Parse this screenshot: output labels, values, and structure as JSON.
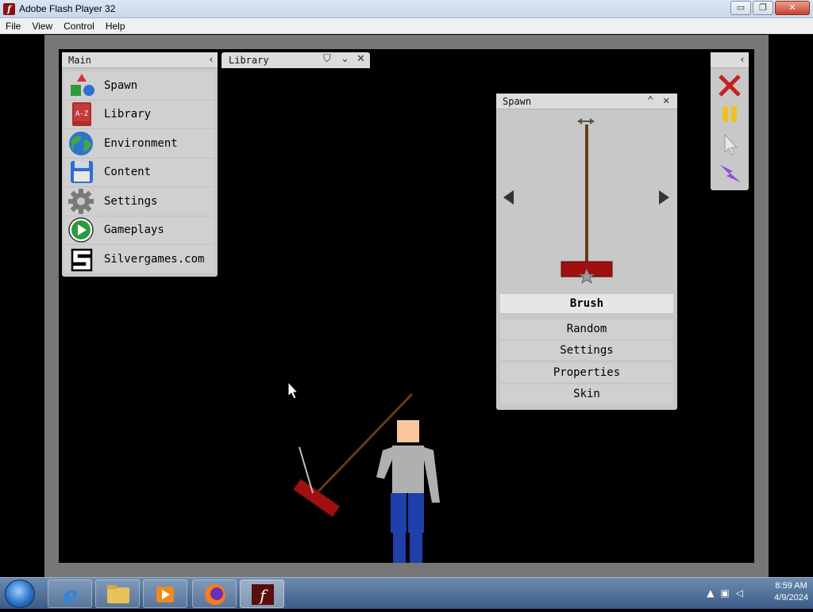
{
  "window": {
    "title": "Adobe Flash Player 32",
    "app_icon": "f",
    "minimize_icon": "▭",
    "restore_icon": "❐",
    "close_icon": "✕"
  },
  "menubar": {
    "items": [
      "File",
      "View",
      "Control",
      "Help"
    ]
  },
  "main_panel": {
    "title": "Main",
    "collapse_icon": "‹",
    "items": [
      {
        "label": "Spawn",
        "icon": "spawn-shapes-icon"
      },
      {
        "label": "Library",
        "icon": "library-book-icon"
      },
      {
        "label": "Environment",
        "icon": "globe-icon"
      },
      {
        "label": "Content",
        "icon": "floppy-disk-icon"
      },
      {
        "label": "Settings",
        "icon": "gear-icon"
      },
      {
        "label": "Gameplays",
        "icon": "play-icon"
      },
      {
        "label": "Silvergames.com",
        "icon": "silvergames-logo-icon"
      }
    ]
  },
  "library_tab": {
    "title": "Library",
    "shield_icon": "⛉",
    "chevron_icon": "⌄",
    "close_icon": "✕"
  },
  "spawn_panel": {
    "title": "Spawn",
    "collapse_icon": "⌃",
    "close_icon": "✕",
    "selected_item": "Brush",
    "buttons": [
      "Random",
      "Settings",
      "Properties",
      "Skin"
    ]
  },
  "tool_panel": {
    "collapse_icon": "‹",
    "tools": [
      "delete-x-icon",
      "pause-icon",
      "cursor-icon",
      "lightning-icon"
    ]
  },
  "taskbar": {
    "time": "8:59 AM",
    "date": "4/9/2024",
    "tray_arrow": "▲"
  },
  "colors": {
    "stage_bg": "#000000",
    "panel_bg": "#c8c8c8",
    "brush_red": "#a01010",
    "brush_handle": "#6b3a12"
  }
}
